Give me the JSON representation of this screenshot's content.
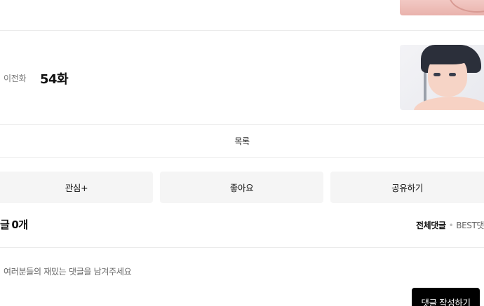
{
  "next_episode": {
    "thumbnail": "episode-thumbnail"
  },
  "prev_episode": {
    "label": "이전화",
    "title": "54화",
    "thumbnail": "episode-thumbnail"
  },
  "navigation": {
    "list_label": "목록"
  },
  "actions": {
    "favorite_label": "관심+",
    "like_label": "좋아요",
    "share_label": "공유하기"
  },
  "comments": {
    "heading": "글",
    "count": "0개",
    "filter_all": "전체댓글",
    "filter_separator": "•",
    "filter_best": "BEST댓",
    "input_placeholder": "여러분들의 재밌는 댓글을 남겨주세요",
    "input_value": "",
    "submit_label": "댓글 작성하기"
  },
  "colors": {
    "button_bg": "#f5f5f5",
    "submit_bg": "#000000",
    "divider": "#ebebeb"
  }
}
